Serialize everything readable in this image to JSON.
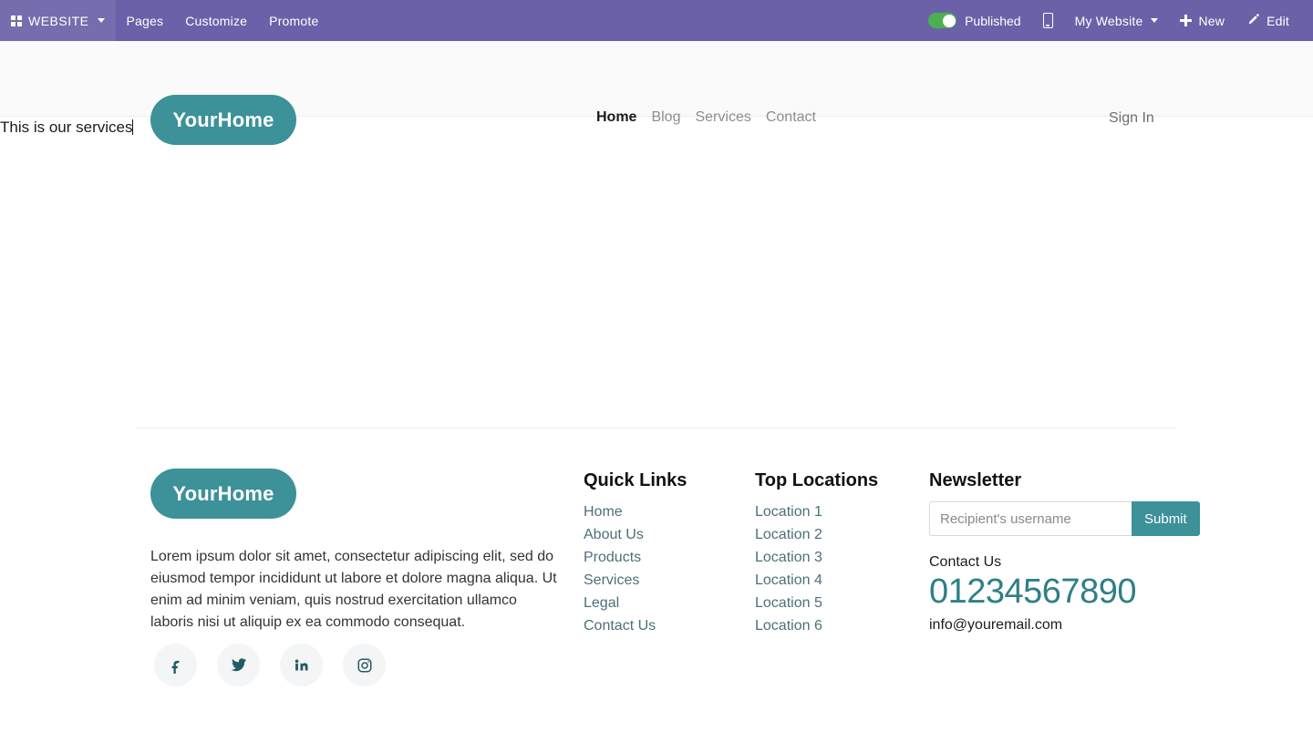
{
  "admin_bar": {
    "brand": {
      "icon": "grid-icon",
      "label": "WEBSITE",
      "caret": "chevron-down-icon"
    },
    "menu": [
      {
        "label": "Pages"
      },
      {
        "label": "Customize"
      },
      {
        "label": "Promote"
      }
    ],
    "publish_toggle": {
      "state": "on",
      "label": "Published",
      "color": "#4caf50"
    },
    "mobile_preview_icon": "mobile-phone-icon",
    "site_selector": {
      "label": "My Website",
      "caret": "chevron-down-icon"
    },
    "new_button": {
      "icon": "plus-icon",
      "label": "New"
    },
    "edit_button": {
      "icon": "pencil-icon",
      "label": "Edit"
    },
    "background_color": "#6b61a8"
  },
  "site_header": {
    "logo": "YourHome",
    "nav": [
      {
        "label": "Home",
        "active": true
      },
      {
        "label": "Blog",
        "active": false
      },
      {
        "label": "Services",
        "active": false
      },
      {
        "label": "Contact",
        "active": false
      }
    ],
    "sign_in": "Sign In",
    "accent_color": "#3d9199",
    "background_color": "#fafafa"
  },
  "page_body": {
    "text": "This is our services",
    "cursor_visible": true
  },
  "footer": {
    "logo": "YourHome",
    "description": "Lorem ipsum dolor sit amet, consectetur adipiscing elit, sed do eiusmod tempor incididunt ut labore et dolore magna aliqua. Ut enim ad minim veniam, quis nostrud exercitation ullamco laboris nisi ut aliquip ex ea commodo consequat.",
    "social": [
      {
        "name": "facebook-icon"
      },
      {
        "name": "twitter-icon"
      },
      {
        "name": "linkedin-icon"
      },
      {
        "name": "instagram-icon"
      }
    ],
    "quick_links": {
      "title": "Quick Links",
      "items": [
        {
          "label": "Home"
        },
        {
          "label": "About Us"
        },
        {
          "label": "Products"
        },
        {
          "label": "Services"
        },
        {
          "label": "Legal"
        },
        {
          "label": "Contact Us"
        }
      ]
    },
    "top_locations": {
      "title": "Top Locations",
      "items": [
        {
          "label": "Location 1"
        },
        {
          "label": "Location 2"
        },
        {
          "label": "Location 3"
        },
        {
          "label": "Location 4"
        },
        {
          "label": "Location 5"
        },
        {
          "label": "Location 6"
        }
      ]
    },
    "newsletter": {
      "title": "Newsletter",
      "input_placeholder": "Recipient's username",
      "input_value": "",
      "submit_label": "Submit",
      "contact_label": "Contact Us",
      "phone": "01234567890",
      "email": "info@youremail.com",
      "phone_color": "#2f7f87"
    }
  }
}
